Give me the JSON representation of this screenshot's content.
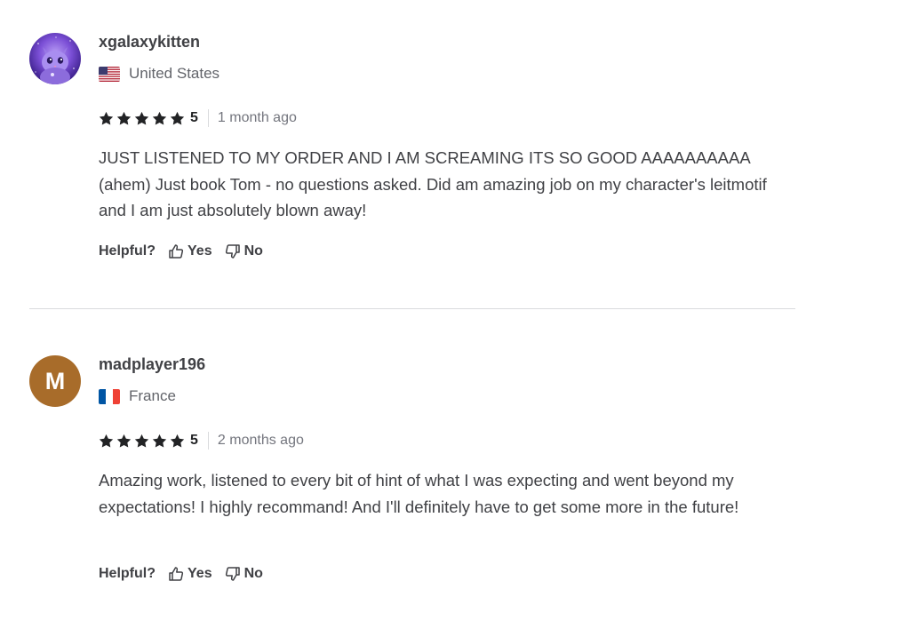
{
  "colors": {
    "text_primary": "#404145",
    "text_secondary": "#62646a",
    "star": "#222325",
    "divider": "#dadbdd",
    "avatar_letter_bg": "#a86c2a"
  },
  "reviews": [
    {
      "username": "xgalaxykitten",
      "avatar": {
        "type": "image",
        "icon": "galaxy-kitten-avatar-icon"
      },
      "country": "United States",
      "flag_icon": "us-flag-icon",
      "rating": "5",
      "stars": 5,
      "time_ago": "1 month ago",
      "text": "JUST LISTENED TO MY ORDER AND I AM SCREAMING ITS SO GOOD AAAAAAAAAA (ahem) Just book Tom - no questions asked. Did am amazing job on my character's leitmotif and I am just absolutely blown away!",
      "helpful_label": "Helpful?",
      "yes_label": "Yes",
      "no_label": "No"
    },
    {
      "username": "madplayer196",
      "avatar": {
        "type": "letter",
        "letter": "M"
      },
      "country": "France",
      "flag_icon": "france-flag-icon",
      "rating": "5",
      "stars": 5,
      "time_ago": "2 months ago",
      "text": "Amazing work, listened to every bit of hint of what I was expecting and went beyond my expectations! I highly recommand! And I'll definitely have to get some more in the future!",
      "helpful_label": "Helpful?",
      "yes_label": "Yes",
      "no_label": "No"
    }
  ]
}
